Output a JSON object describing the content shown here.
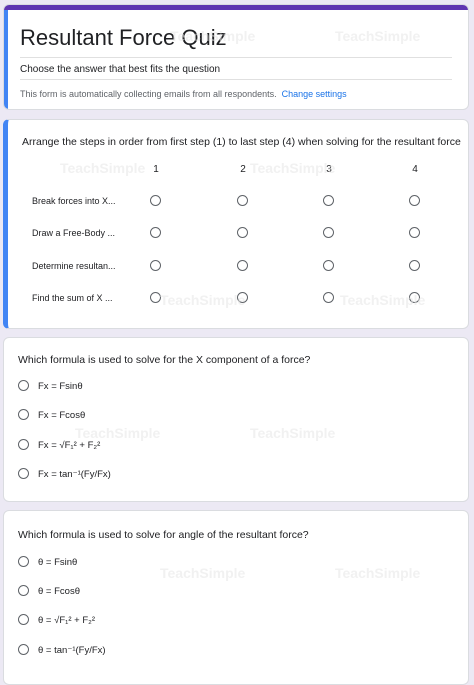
{
  "form": {
    "title": "Resultant Force Quiz",
    "description": "Choose the answer that best fits the question",
    "email_notice": "This form is automatically collecting emails from all respondents.",
    "change_settings": "Change settings"
  },
  "grid_question": {
    "text": "Arrange the steps in order from first step (1) to last step (4) when solving for the resultant force",
    "columns": [
      "1",
      "2",
      "3",
      "4"
    ],
    "rows": [
      "Break forces into X...",
      "Draw a Free-Body ...",
      "Determine resultan...",
      "Find the sum of X ..."
    ]
  },
  "question2": {
    "text": "Which formula is used to solve for the X component of a force?",
    "options": [
      "Fx = Fsinθ",
      "Fx = Fcosθ",
      "Fx = √F₁² + F₂²",
      "Fx = tan⁻¹(Fy/Fx)"
    ]
  },
  "question3": {
    "text": "Which formula is used to solve for angle of the resultant force?",
    "options": [
      "θ = Fsinθ",
      "θ = Fcosθ",
      "θ = √F₁² + F₂²",
      "θ = tan⁻¹(Fy/Fx)"
    ]
  },
  "watermark": "TeachSimple",
  "colors": {
    "header_bar": "#5e35b1",
    "active_accent": "#4285f4",
    "link": "#1a73e8",
    "background": "#ece9f4"
  }
}
